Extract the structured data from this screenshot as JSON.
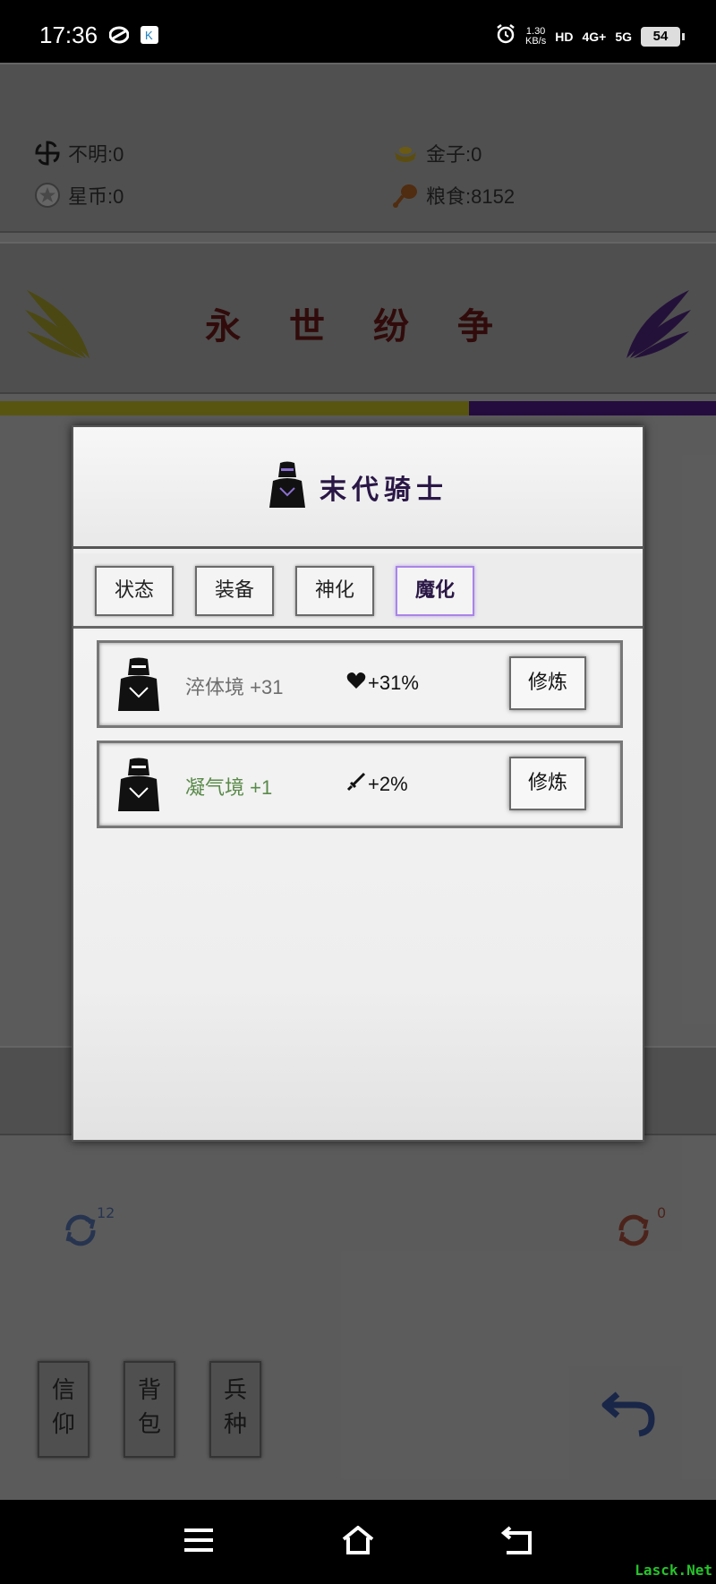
{
  "status_bar": {
    "time": "17:36",
    "net_speed_value": "1.30",
    "net_speed_unit": "KB/s",
    "hd_tag": "HD",
    "signal1": "4G+",
    "signal2": "5G",
    "battery": "54"
  },
  "resources": {
    "unknown": "不明:0",
    "gold": "金子:0",
    "star_coin": "星币:0",
    "food": "粮食:8152"
  },
  "title": "永 世 纷 争",
  "progress_fraction": 0.655,
  "modal": {
    "unit_name": "末代骑士",
    "tabs": [
      {
        "label": "状态"
      },
      {
        "label": "装备"
      },
      {
        "label": "神化"
      },
      {
        "label": "魔化"
      }
    ],
    "active_tab": "魔化",
    "rows": [
      {
        "realm": "淬体境 +31",
        "realm_color": "#6e6e6e",
        "bonus_icon": "heart-icon",
        "bonus": "+31%",
        "action": "修炼"
      },
      {
        "realm": "凝气境 +1",
        "realm_color": "#5a8a4a",
        "bonus_icon": "sword-icon",
        "bonus": "+2%",
        "action": "修炼"
      }
    ]
  },
  "refresh": {
    "left_count": "12",
    "right_count": "0"
  },
  "side_buttons": [
    {
      "label_top": "信",
      "label_bottom": "仰"
    },
    {
      "label_top": "背",
      "label_bottom": "包"
    },
    {
      "label_top": "兵",
      "label_bottom": "种"
    }
  ],
  "colors": {
    "accent_purple": "#a985e6",
    "progress_yellow": "#686414",
    "progress_purple": "#2b0f4a",
    "title_red": "#3a0e0e"
  },
  "watermark": "Lasck.Net"
}
